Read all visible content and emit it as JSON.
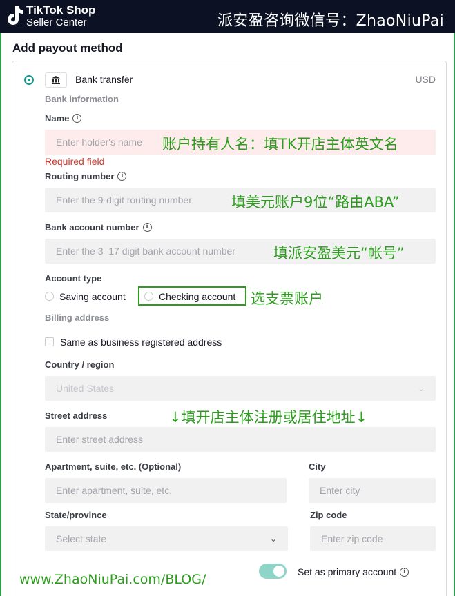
{
  "header": {
    "logo_line1": "TikTok Shop",
    "logo_line2": "Seller Center",
    "banner": "派安盈咨询微信号：ZhaoNiuPai"
  },
  "page_title": "Add payout method",
  "method": {
    "label": "Bank transfer",
    "currency": "USD"
  },
  "bank_info": {
    "section": "Bank information",
    "name_label": "Name",
    "name_placeholder": "Enter holder's name",
    "name_error": "Required field",
    "routing_label": "Routing number",
    "routing_placeholder": "Enter the 9-digit routing number",
    "account_label": "Bank account number",
    "account_placeholder": "Enter the 3–17 digit bank account number"
  },
  "account_type": {
    "label": "Account type",
    "options": [
      "Saving account",
      "Checking account"
    ]
  },
  "billing": {
    "section": "Billing address",
    "same_as_label": "Same as business registered address",
    "country_label": "Country / region",
    "country_value": "United States",
    "street_label": "Street address",
    "street_placeholder": "Enter street address",
    "apt_label": "Apartment, suite, etc. (Optional)",
    "apt_placeholder": "Enter apartment, suite, etc.",
    "city_label": "City",
    "city_placeholder": "Enter city",
    "state_label": "State/province",
    "state_placeholder": "Select state",
    "zip_label": "Zip code",
    "zip_placeholder": "Enter zip code"
  },
  "primary": {
    "label": "Set as primary account",
    "enabled": true
  },
  "annotations": {
    "name_note": "账户持有人名：填TK开店主体英文名",
    "routing_note": "填美元账户9位“路由ABA”",
    "account_note": "填派安盈美元“帐号”",
    "type_note": "选支票账户",
    "address_note": "↓填开店主体注册或居住地址↓",
    "footer_url": "www.ZhaoNiuPai.com/BLOG/"
  },
  "colors": {
    "accent": "#129c8e",
    "annotation": "#2e9c1f",
    "error": "#d1382e"
  }
}
